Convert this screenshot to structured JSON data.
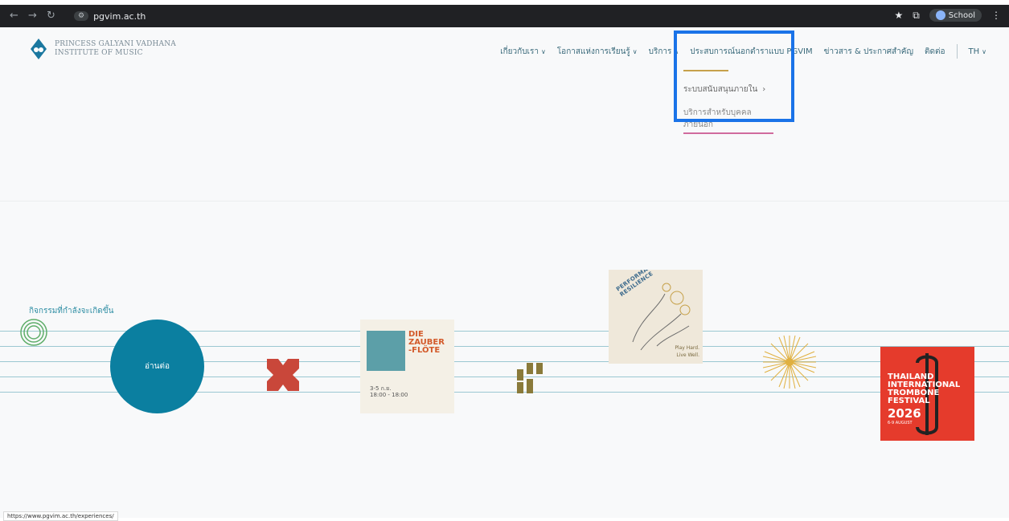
{
  "browser": {
    "url": "pgvim.ac.th",
    "profile": "School"
  },
  "site": {
    "logo_line1": "PRINCESS GALYANI VADHANA",
    "logo_line2": "INSTITUTE OF MUSIC",
    "nav": [
      {
        "label": "เกี่ยวกับเรา"
      },
      {
        "label": "โอกาสแห่งการเรียนรู้"
      },
      {
        "label": "บริการ"
      },
      {
        "label": "ประสบการณ์นอกตำราแบบ PGVIM"
      },
      {
        "label": "ข่าวสาร & ประกาศสำคัญ"
      },
      {
        "label": "ติดต่อ"
      },
      {
        "label": "TH"
      }
    ],
    "dropdown": {
      "item1": "ระบบสนับสนุนภายใน",
      "item2": "บริการสำหรับบุคคลภายนอก"
    },
    "events_title": "กิจกรรมที่กำลังจะเกิดขึ้น",
    "read_more": "อ่านต่อ"
  },
  "posters": {
    "zauber": {
      "title_1": "DIE",
      "title_2": "ZAUBER",
      "title_3": "-FLÖTE",
      "date": "3-5 ก.ย.",
      "time": "18:00 - 18:00"
    },
    "performance": {
      "title": "PERFORMANCE RESILIENCE",
      "tag1": "Play Hard.",
      "tag2": "Live Well."
    },
    "trombone": {
      "line1": "THAILAND",
      "line2": "INTERNATIONAL",
      "line3": "TROMBONE",
      "line4": "FESTIVAL",
      "year": "2026",
      "dates": "6-9 AUGUST"
    }
  },
  "status_url": "https://www.pgvim.ac.th/experiences/",
  "colors": {
    "teal": "#0b7fa0",
    "highlight": "#1a73e8",
    "underline": "#c6a14a"
  }
}
